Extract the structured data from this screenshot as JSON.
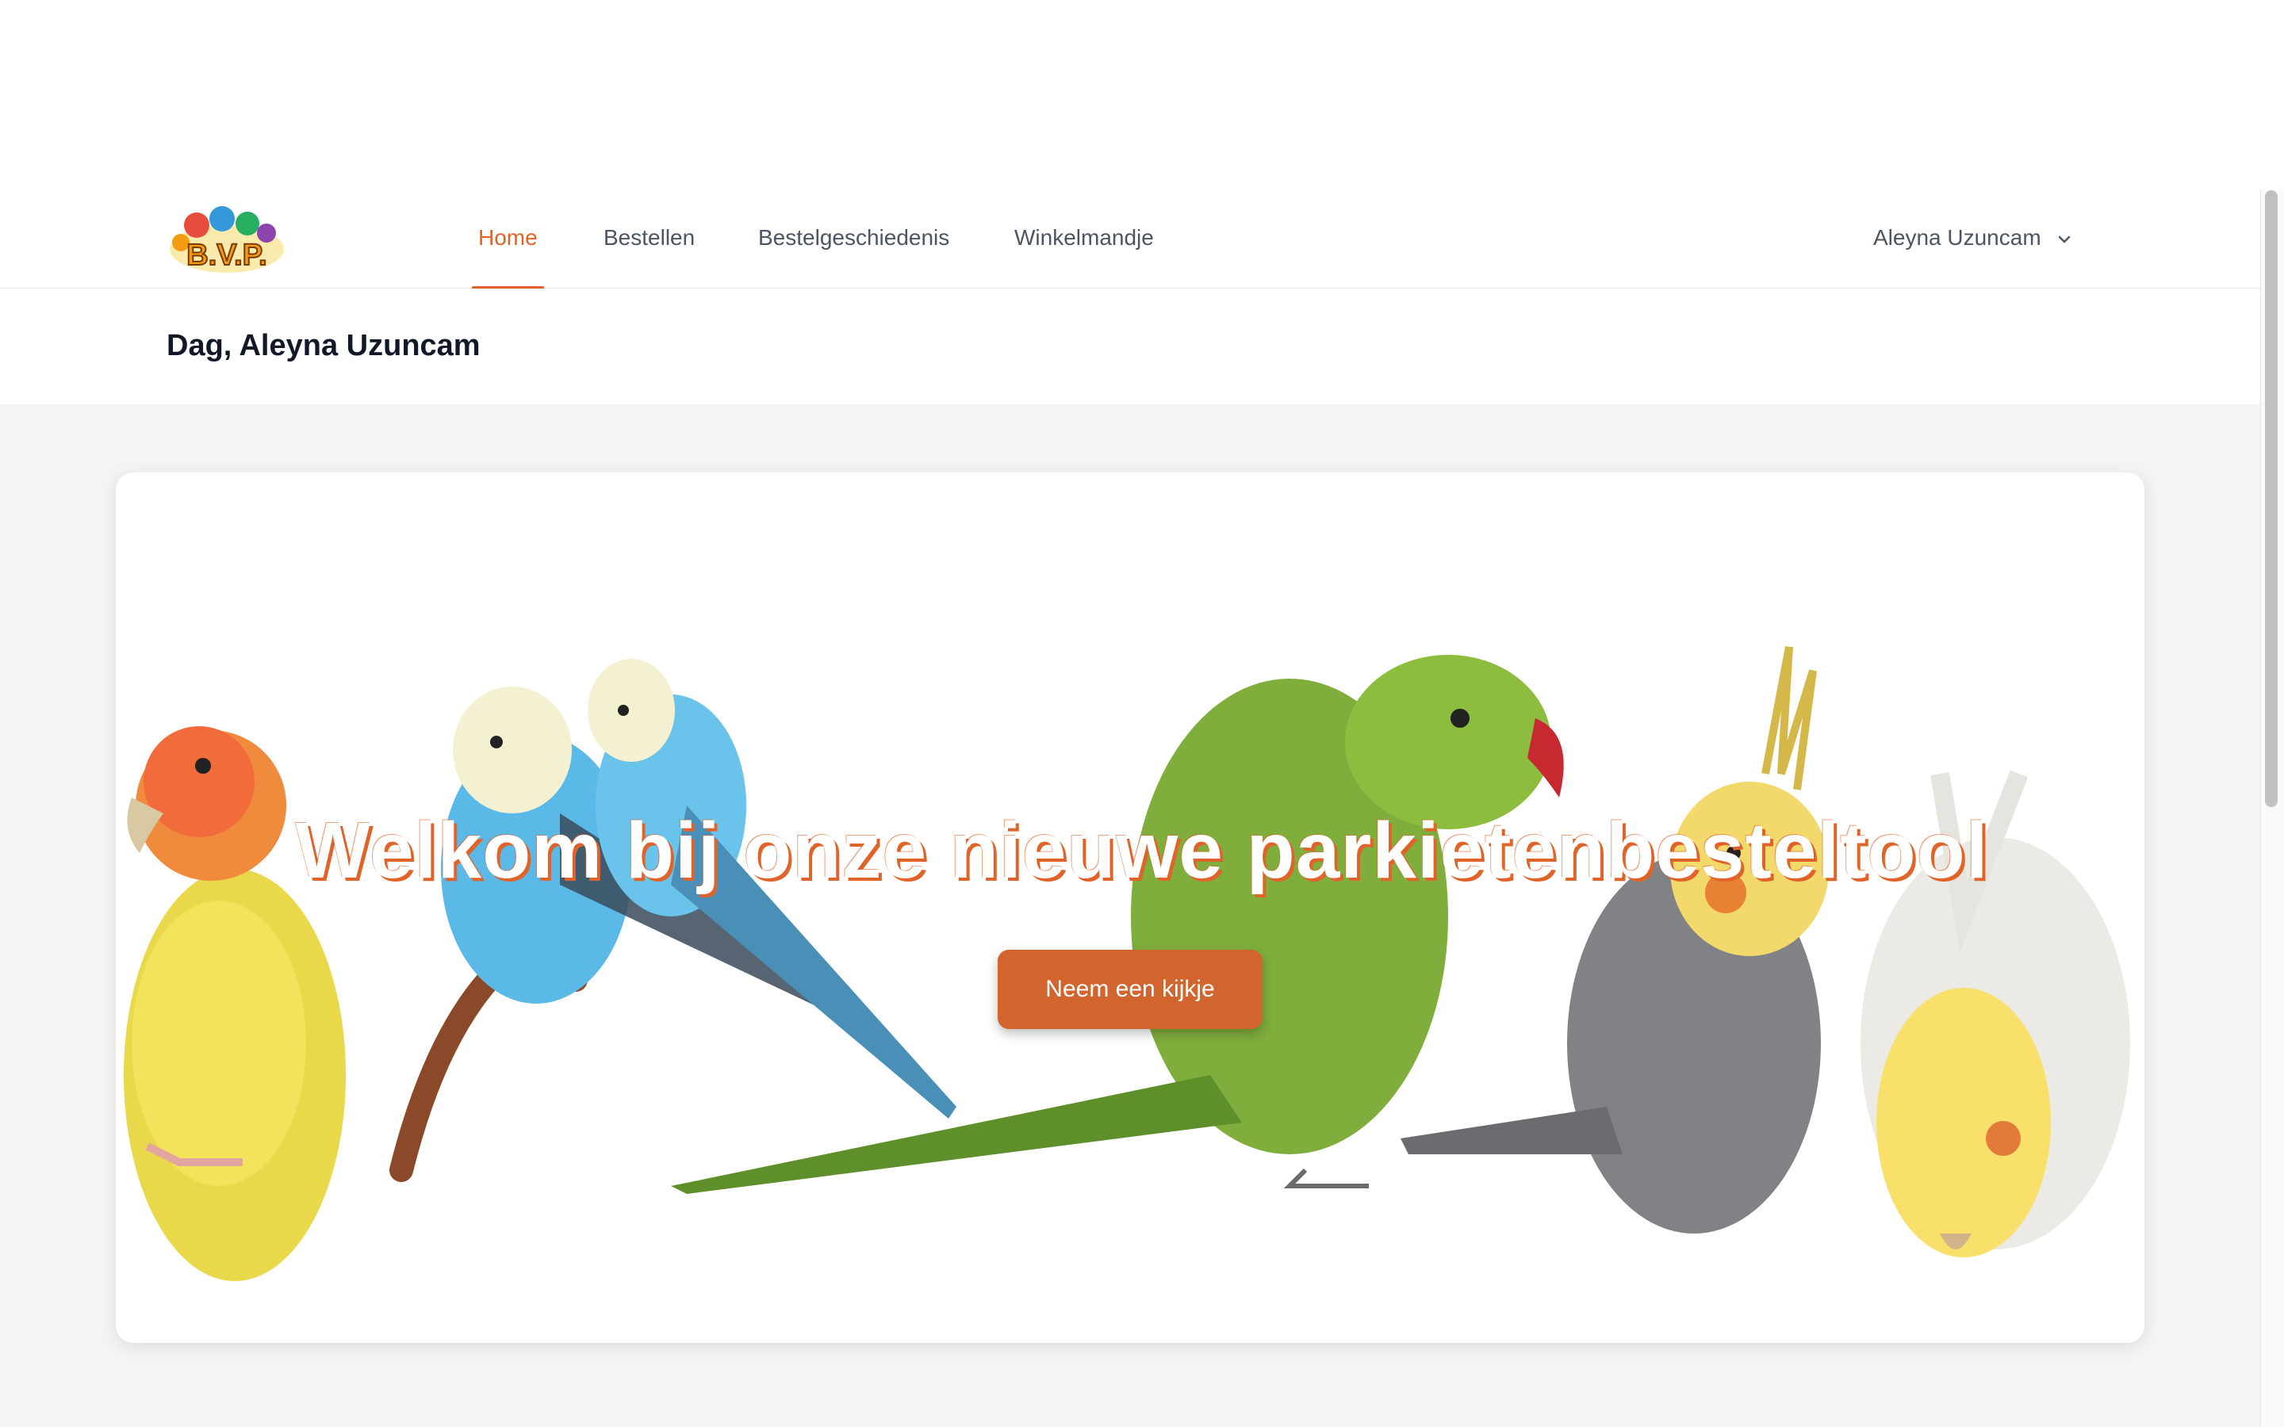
{
  "nav": {
    "tabs": [
      {
        "label": "Home",
        "active": true
      },
      {
        "label": "Bestellen",
        "active": false
      },
      {
        "label": "Bestelgeschiedenis",
        "active": false
      },
      {
        "label": "Winkelmandje",
        "active": false
      }
    ],
    "user_name": "Aleyna Uzuncam",
    "logo_text": "B.V.P."
  },
  "greeting": "Dag, Aleyna Uzuncam",
  "hero": {
    "title": "Welkom bij onze nieuwe parkietenbesteltool",
    "cta_label": "Neem een kijkje"
  },
  "colors": {
    "accent": "#e0632a",
    "button": "#d2652e",
    "background": "#f3f4f6"
  }
}
